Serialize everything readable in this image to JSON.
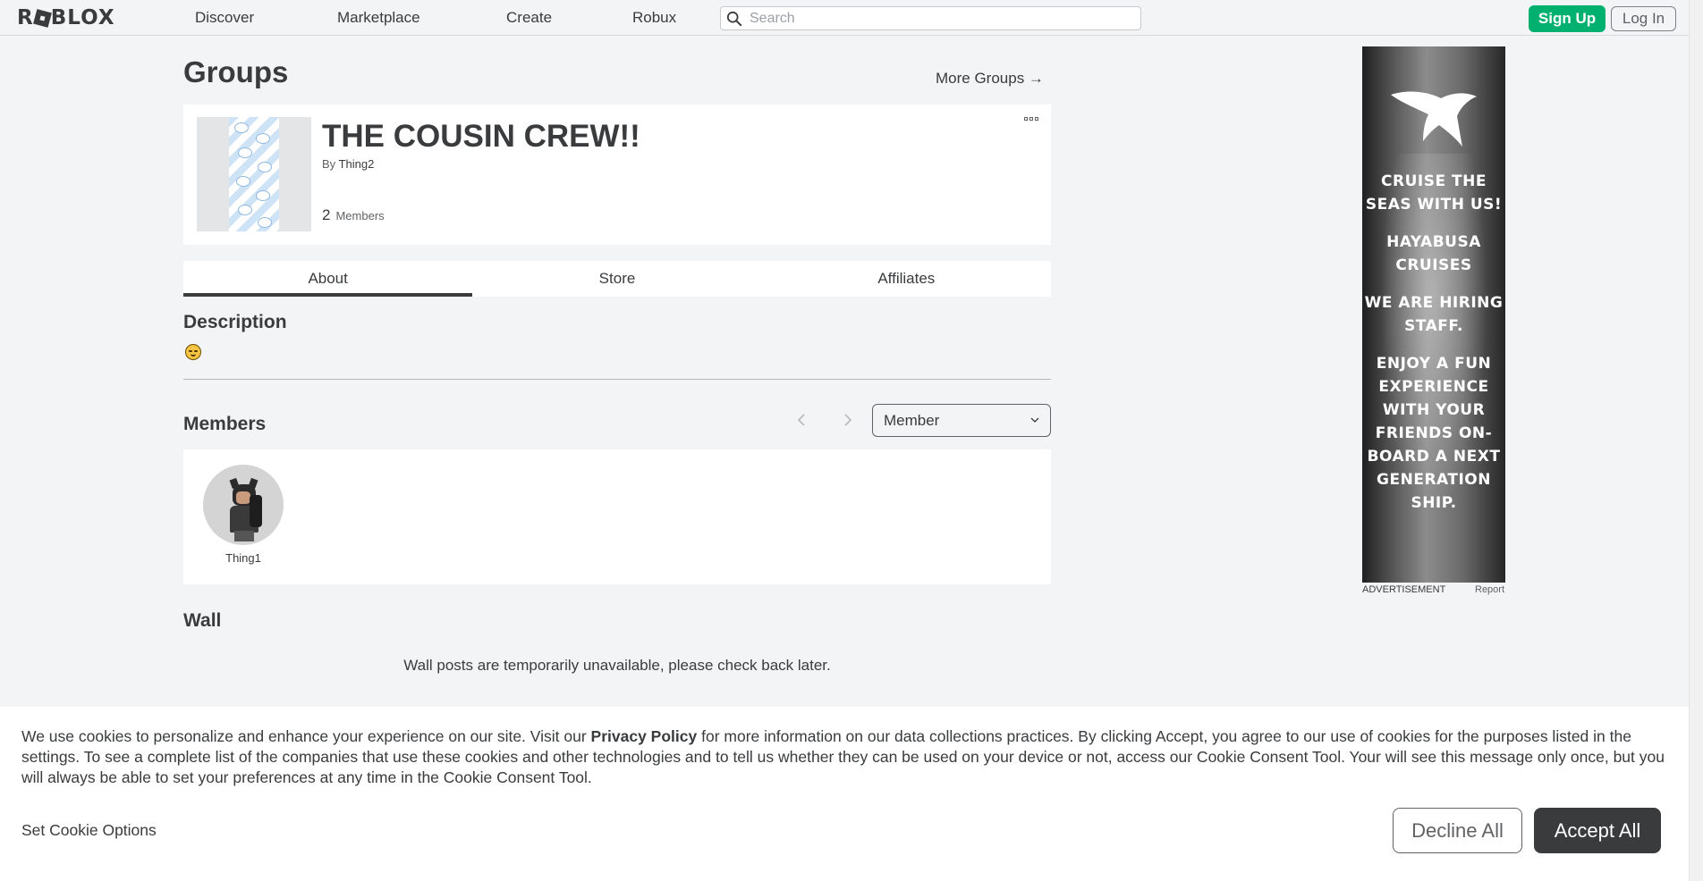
{
  "nav": {
    "logo": "ROBLOX",
    "links": [
      "Discover",
      "Marketplace",
      "Create",
      "Robux"
    ],
    "search_placeholder": "Search",
    "signup": "Sign Up",
    "login": "Log In"
  },
  "page": {
    "title": "Groups",
    "more_groups": "More Groups →"
  },
  "group": {
    "name": "THE COUSIN CREW!!",
    "by_label": "By",
    "owner": "Thing2",
    "members_count": "2",
    "members_label": "Members"
  },
  "tabs": [
    "About",
    "Store",
    "Affiliates"
  ],
  "about": {
    "description_heading": "Description",
    "description_emoji": "😔",
    "members_heading": "Members",
    "role_select": "Member",
    "members": [
      {
        "name": "Thing1"
      }
    ],
    "wall_heading": "Wall",
    "wall_message": "Wall posts are temporarily unavailable, please check back later."
  },
  "ad": {
    "lines": [
      "CRUISE THE SEAS WITH US!",
      "HAYABUSA CRUISES",
      "WE ARE HIRING STAFF.",
      "ENJOY A FUN EXPERIENCE WITH YOUR FRIENDS ON-BOARD A NEXT GENERATION SHIP."
    ],
    "label": "ADVERTISEMENT",
    "report": "Report"
  },
  "cookie": {
    "text_part1": "We use cookies to personalize and enhance your experience on our site. Visit our ",
    "privacy_link": "Privacy Policy",
    "text_part2": " for more information on our data collections practices. By clicking Accept, you agree to our use of cookies for the purposes listed in the settings. To see a complete list of the companies that use these cookies and other technologies and to tell us whether they can be used on your device or not, access our Cookie Consent Tool. Your will see this message only once, but you will always be able to set your preferences at any time in the Cookie Consent Tool.",
    "set_options": "Set Cookie Options",
    "decline": "Decline All",
    "accept": "Accept All"
  },
  "colors": {
    "accent_green": "#00b06f",
    "text_dark": "#393b3d",
    "background": "#f2f4f5"
  }
}
